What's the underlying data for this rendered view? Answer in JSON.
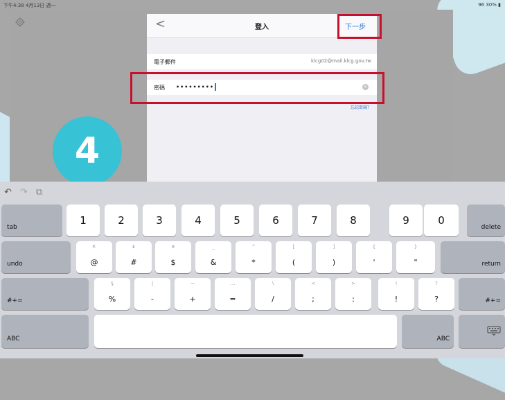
{
  "status_bar": {
    "time": "下午4:38 4月13日 週一",
    "battery": "96 30% ▮"
  },
  "modal": {
    "title": "登入",
    "back_label": "<",
    "next_label": "下一步",
    "email_label": "電子郵件",
    "email_value": "klcg02@mail.klcg.gov.tw",
    "password_label": "密碼",
    "password_value": "•••••••••",
    "forgot_label": "忘記密碼？"
  },
  "step_badge": "4",
  "toolbar": {
    "undo": "↶",
    "redo": "↷",
    "paste": "⧉"
  },
  "keyboard": {
    "tab": "tab",
    "delete": "delete",
    "undo": "undo",
    "return": "return",
    "shift": "#+=",
    "shift_right": "#+=",
    "abc": "ABC",
    "abc_right": "ABC",
    "digits": [
      "1",
      "2",
      "3",
      "4",
      "5",
      "6",
      "7",
      "8",
      "9",
      "0"
    ],
    "row2": [
      "@",
      "#",
      "$",
      "&",
      "*",
      "(",
      ")",
      "'",
      "\""
    ],
    "row2_hints": [
      "€",
      "£",
      "¥",
      "_",
      "^",
      "[",
      "]",
      "{",
      "}"
    ],
    "row3": [
      "%",
      "-",
      "+",
      "=",
      "/",
      ";",
      ":",
      "!",
      "?"
    ],
    "row3_hints": [
      "§",
      "|",
      "~",
      "…",
      "\\",
      "<",
      ">",
      "!",
      "?"
    ]
  },
  "colors": {
    "highlight": "#c8102e",
    "badge": "#37c2d6",
    "link": "#2b77dd"
  }
}
